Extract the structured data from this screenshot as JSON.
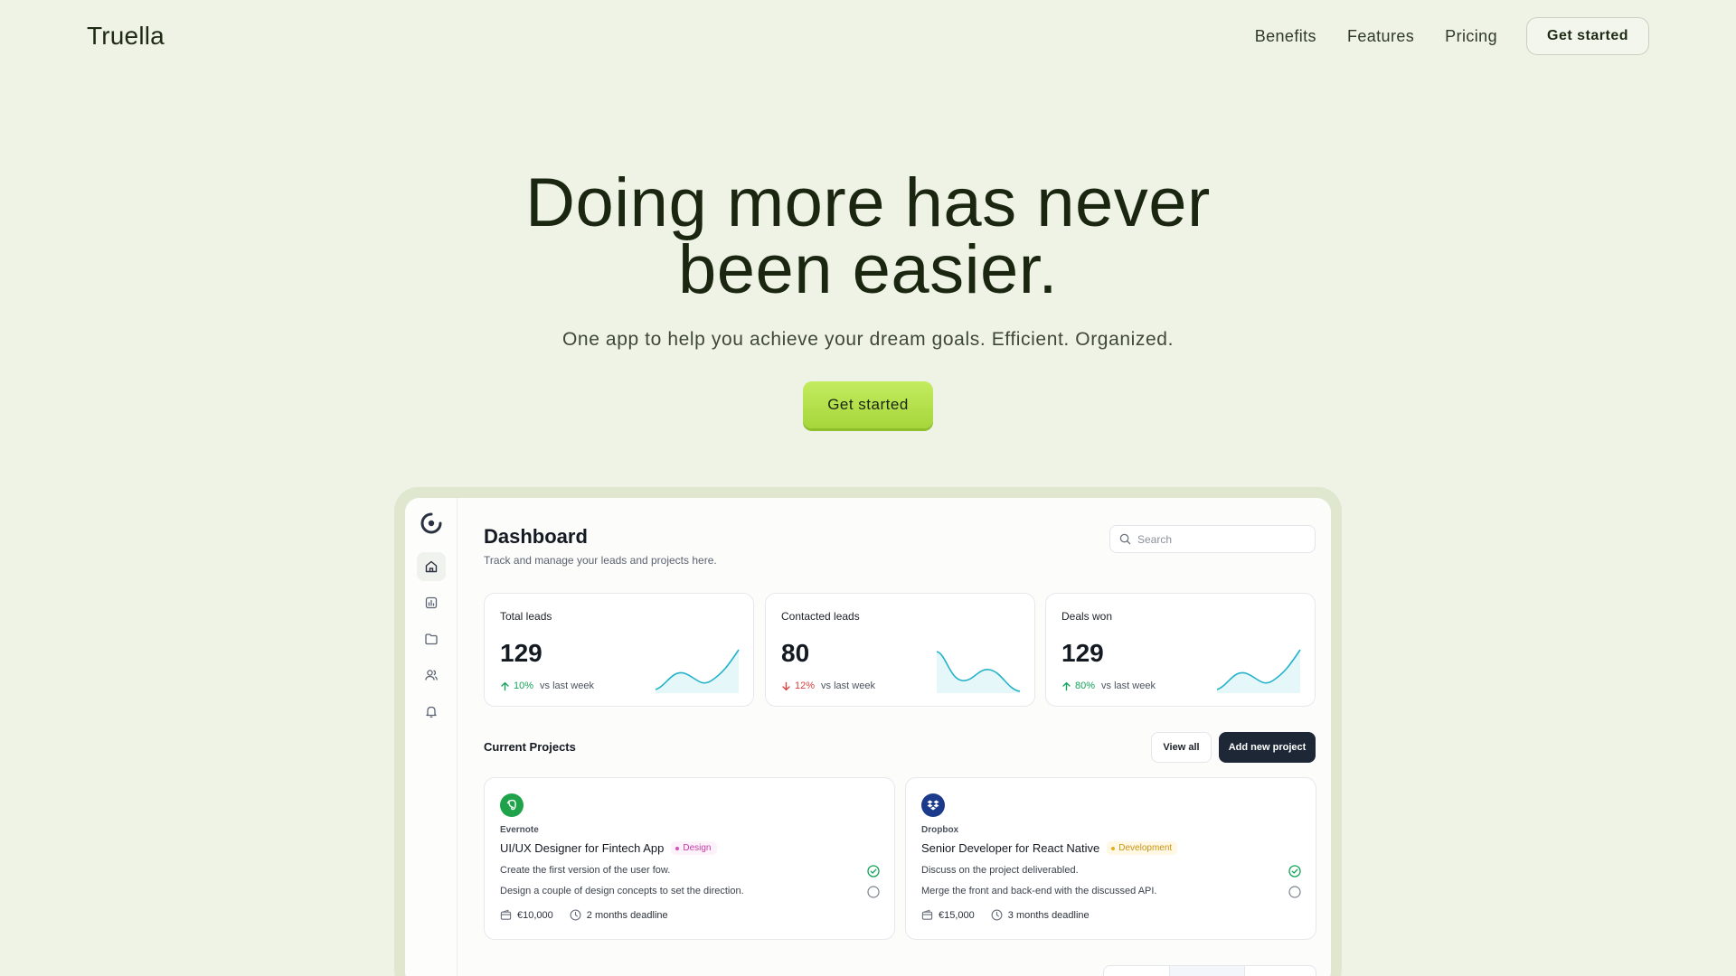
{
  "brand": "Truella",
  "nav": {
    "links": [
      "Benefits",
      "Features",
      "Pricing"
    ],
    "cta": "Get started"
  },
  "hero": {
    "title_line1": "Doing more has never",
    "title_line2": "been easier.",
    "subtitle": "One app to help you achieve your dream goals. Efficient. Organized.",
    "cta": "Get started"
  },
  "dashboard": {
    "title": "Dashboard",
    "subtitle": "Track and manage your leads and projects here.",
    "search_placeholder": "Search",
    "sidebar_icons": [
      "logo-icon",
      "home-icon",
      "chart-icon",
      "folder-icon",
      "users-icon",
      "bell-icon"
    ],
    "stats": [
      {
        "label": "Total leads",
        "value": "129",
        "trend": "10%",
        "direction": "up",
        "note": "vs last week",
        "color": "#14a35a"
      },
      {
        "label": "Contacted leads",
        "value": "80",
        "trend": "12%",
        "direction": "down",
        "note": "vs last week",
        "color": "#d64040"
      },
      {
        "label": "Deals won",
        "value": "129",
        "trend": "80%",
        "direction": "up",
        "note": "vs last week",
        "color": "#14a35a"
      }
    ],
    "projects_heading": "Current Projects",
    "view_all": "View all",
    "add_project": "Add new project",
    "projects": [
      {
        "company": "Evernote",
        "title": "UI/UX Designer for Fintech App",
        "tag": "Design",
        "tasks": [
          {
            "text": "Create the first version of the user fow.",
            "done": true
          },
          {
            "text": "Design a couple of design concepts to set the direction.",
            "done": false
          }
        ],
        "budget": "€10,000",
        "deadline": "2 months deadline",
        "logo_color": "#1fa34a"
      },
      {
        "company": "Dropbox",
        "title": "Senior Developer for React Native",
        "tag": "Development",
        "tasks": [
          {
            "text": "Discuss on the project deliverabled.",
            "done": true
          },
          {
            "text": "Merge the front and back-end with the discussed API.",
            "done": false
          }
        ],
        "budget": "€15,000",
        "deadline": "3 months deadline",
        "logo_color": "#1c3a8c"
      }
    ]
  },
  "colors": {
    "background": "#eef3e6",
    "accent": "#b4e24c",
    "sparkline": "#22b3c9",
    "dark_button": "#1d2735"
  }
}
